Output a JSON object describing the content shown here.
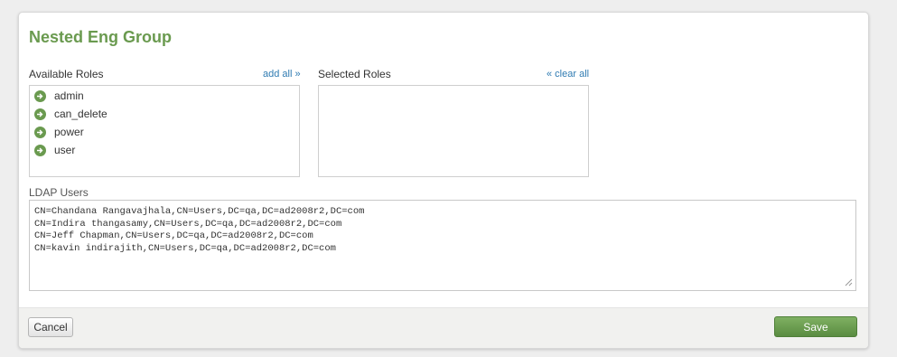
{
  "dialog": {
    "title": "Nested Eng Group"
  },
  "available_roles": {
    "label": "Available Roles",
    "add_all": "add all »",
    "items": [
      {
        "label": "admin"
      },
      {
        "label": "can_delete"
      },
      {
        "label": "power"
      },
      {
        "label": "user"
      }
    ],
    "item_icon": "green-arrow-circle-icon",
    "accent_color": "#6a9a4f"
  },
  "selected_roles": {
    "label": "Selected Roles",
    "clear_all": "« clear all",
    "items": []
  },
  "ldap": {
    "label": "LDAP Users",
    "value": "CN=Chandana Rangavajhala,CN=Users,DC=qa,DC=ad2008r2,DC=com\nCN=Indira thangasamy,CN=Users,DC=qa,DC=ad2008r2,DC=com\nCN=Jeff Chapman,CN=Users,DC=qa,DC=ad2008r2,DC=com\nCN=kavin indirajith,CN=Users,DC=qa,DC=ad2008r2,DC=com"
  },
  "footer": {
    "cancel_label": "Cancel",
    "save_label": "Save"
  }
}
